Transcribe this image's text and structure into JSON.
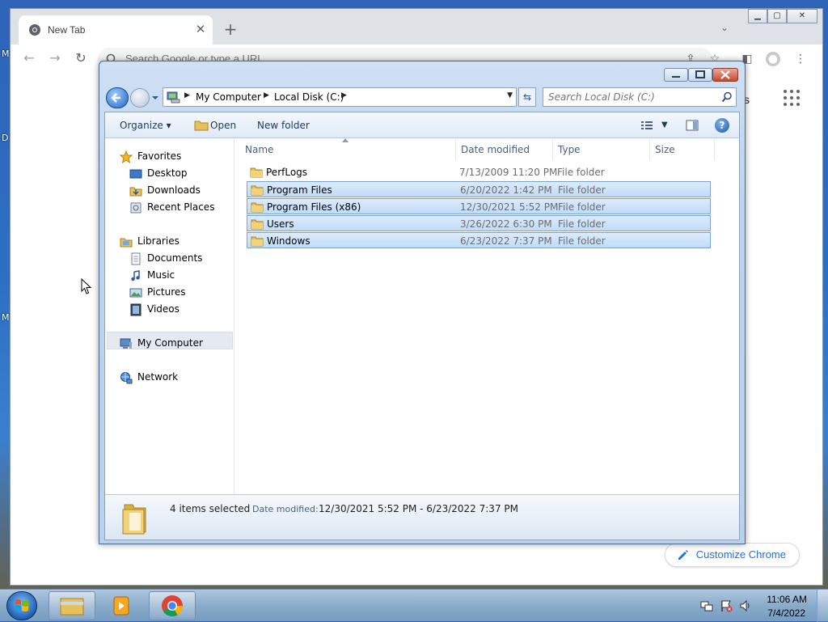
{
  "desktop": {
    "left_letters": [
      "M",
      "D",
      "M"
    ]
  },
  "chrome": {
    "tab_title": "New Tab",
    "omnibox_placeholder": "Search Google or type a URL",
    "ntp_links_text": "ges",
    "customize_label": "Customize Chrome"
  },
  "explorer": {
    "breadcrumbs": [
      "My Computer",
      "Local Disk (C:)"
    ],
    "search_placeholder": "Search Local Disk (C:)",
    "commands": {
      "organize": "Organize",
      "open": "Open",
      "new_folder": "New folder"
    },
    "nav": {
      "favorites": "Favorites",
      "desktop": "Desktop",
      "downloads": "Downloads",
      "recent_places": "Recent Places",
      "libraries": "Libraries",
      "documents": "Documents",
      "music": "Music",
      "pictures": "Pictures",
      "videos": "Videos",
      "my_computer": "My Computer",
      "network": "Network"
    },
    "columns": {
      "name": "Name",
      "date_modified": "Date modified",
      "type": "Type",
      "size": "Size"
    },
    "files": [
      {
        "name": "PerfLogs",
        "date": "7/13/2009 11:20 PM",
        "type": "File folder",
        "selected": false
      },
      {
        "name": "Program Files",
        "date": "6/20/2022 1:42 PM",
        "type": "File folder",
        "selected": true
      },
      {
        "name": "Program Files (x86)",
        "date": "12/30/2021 5:52 PM",
        "type": "File folder",
        "selected": true
      },
      {
        "name": "Users",
        "date": "3/26/2022 6:30 PM",
        "type": "File folder",
        "selected": true
      },
      {
        "name": "Windows",
        "date": "6/23/2022 7:37 PM",
        "type": "File folder",
        "selected": true
      }
    ],
    "details": {
      "count": "4 items selected",
      "date_label": "Date modified:",
      "date_value": "12/30/2021 5:52 PM - 6/23/2022 7:37 PM"
    }
  },
  "taskbar": {
    "time": "11:06 AM",
    "date": "7/4/2022"
  },
  "colors": {
    "selection_bg": "#cce4fc",
    "selection_border": "#7da2ce",
    "link_blue": "#1a73e8"
  }
}
